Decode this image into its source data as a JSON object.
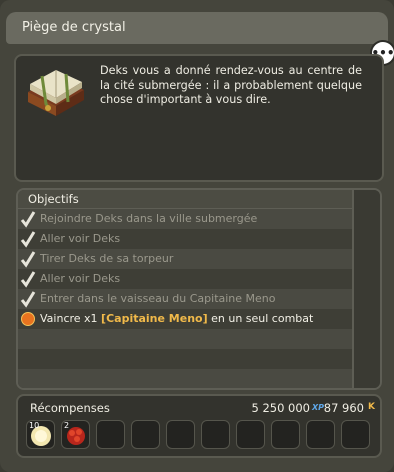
{
  "window": {
    "title": "Piège de crystal",
    "chat_icon": "speech-bubble-icon"
  },
  "description": {
    "icon": "book-icon",
    "text": "Deks vous a donné rendez-vous au centre de la cité submergée : il a probablement quelque chose d'important à vous dire."
  },
  "objectives": {
    "header": "Objectifs",
    "items": [
      {
        "text": "Rejoindre Deks dans la ville submergée",
        "done": true
      },
      {
        "text": "Aller voir Deks",
        "done": true
      },
      {
        "text": "Tirer Deks de sa torpeur",
        "done": true
      },
      {
        "text": "Aller voir Deks",
        "done": true
      },
      {
        "text": "Entrer dans le vaisseau du Capitaine Meno",
        "done": true
      }
    ],
    "active": {
      "prefix": "Vaincre x1",
      "boss": "[Capitaine Meno]",
      "suffix": "en un seul combat"
    }
  },
  "rewards": {
    "label": "Récompenses",
    "xp": "5 250 000",
    "xp_unit": "XP",
    "kamas": "87 960",
    "kamas_unit": "K",
    "items": [
      {
        "qty": "10",
        "icon": "moon-orb-icon"
      },
      {
        "qty": "2",
        "icon": "red-flower-icon"
      }
    ]
  }
}
